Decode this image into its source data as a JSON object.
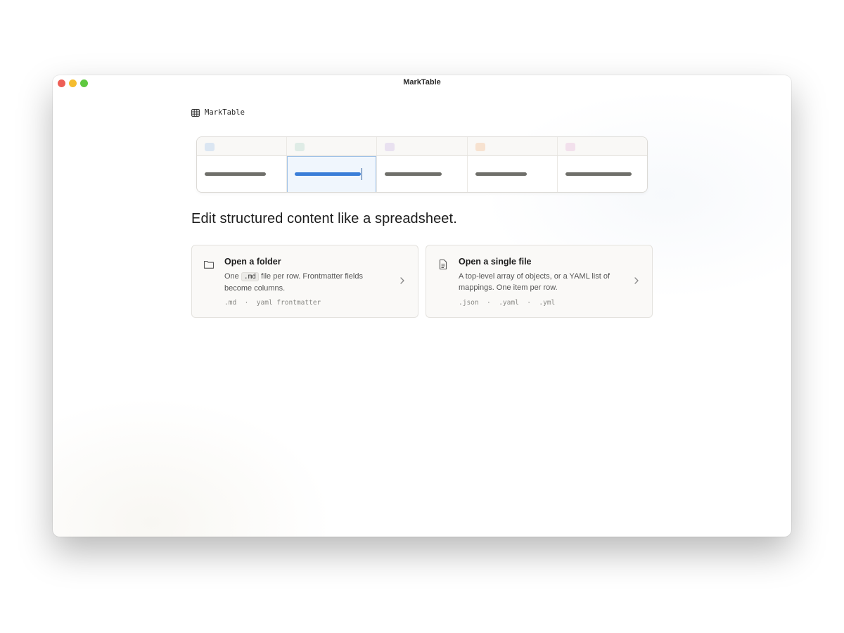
{
  "window": {
    "title": "MarkTable"
  },
  "brand": {
    "name": "MarkTable",
    "icon": "table-icon"
  },
  "preview": {
    "header_chip_colors": [
      "#dbe6f2",
      "#dfece6",
      "#e9e1f0",
      "#f7e2d0",
      "#f2e0ec"
    ],
    "active_column": 1
  },
  "headline": "Edit structured content like a spreadsheet.",
  "cards": {
    "folder": {
      "icon": "folder-icon",
      "title": "Open a folder",
      "desc_prefix": "One",
      "desc_code": ".md",
      "desc_suffix": "file per row. Frontmatter fields become columns.",
      "meta": ".md  ·  yaml frontmatter"
    },
    "file": {
      "icon": "file-icon",
      "title": "Open a single file",
      "desc": "A top-level array of objects, or a YAML list of mappings. One item per row.",
      "meta": ".json  ·  .yaml  ·  .yml"
    }
  }
}
